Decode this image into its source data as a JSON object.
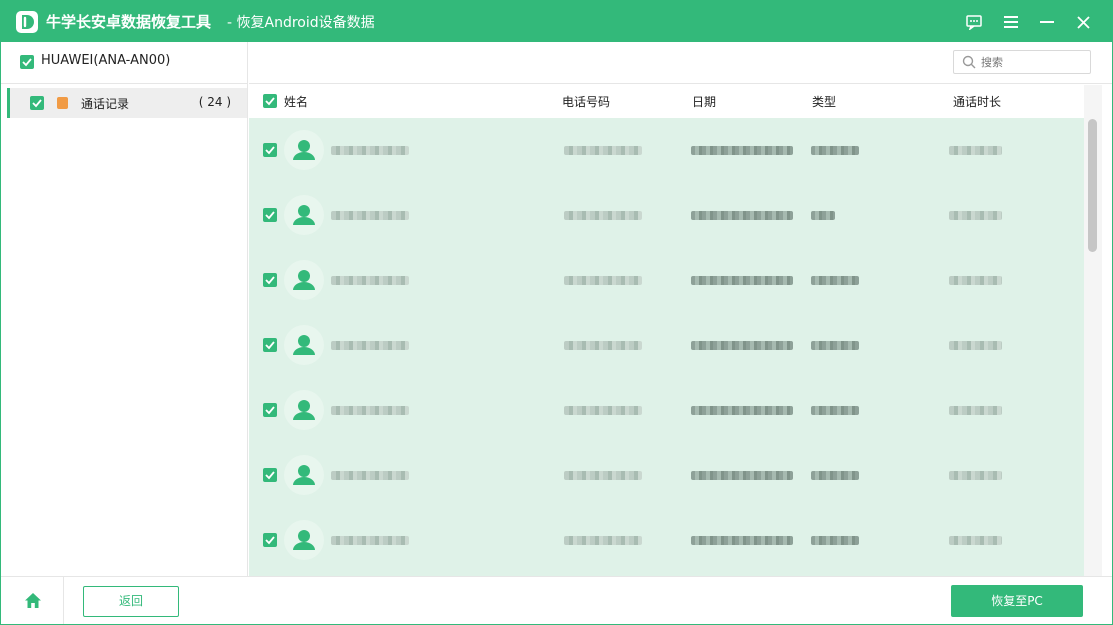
{
  "titlebar": {
    "app_name": "牛学长安卓数据恢复工具",
    "subtitle": "- 恢复Android设备数据",
    "icons": [
      "feedback-icon",
      "menu-icon",
      "minimize-icon",
      "close-icon"
    ]
  },
  "device": {
    "name": "HUAWEI(ANA-AN00)",
    "checked": true
  },
  "categories": [
    {
      "label": "通话记录",
      "count": "( 24 )",
      "icon": "call-log-icon",
      "checked": true
    }
  ],
  "search": {
    "placeholder": "搜索",
    "icon": "search-icon"
  },
  "table": {
    "columns": [
      "姓名",
      "电话号码",
      "日期",
      "类型",
      "通话时长"
    ],
    "rows": [
      {
        "checked": true,
        "values_visible": false
      },
      {
        "checked": true,
        "values_visible": false
      },
      {
        "checked": true,
        "values_visible": false
      },
      {
        "checked": true,
        "values_visible": false
      },
      {
        "checked": true,
        "values_visible": false
      },
      {
        "checked": true,
        "values_visible": false
      },
      {
        "checked": true,
        "values_visible": false
      }
    ]
  },
  "footer": {
    "back_label": "返回",
    "recover_label": "恢复至PC",
    "home_icon": "home-icon"
  },
  "colors": {
    "accent": "#33b97a",
    "row_highlight": "#dff2e8"
  }
}
